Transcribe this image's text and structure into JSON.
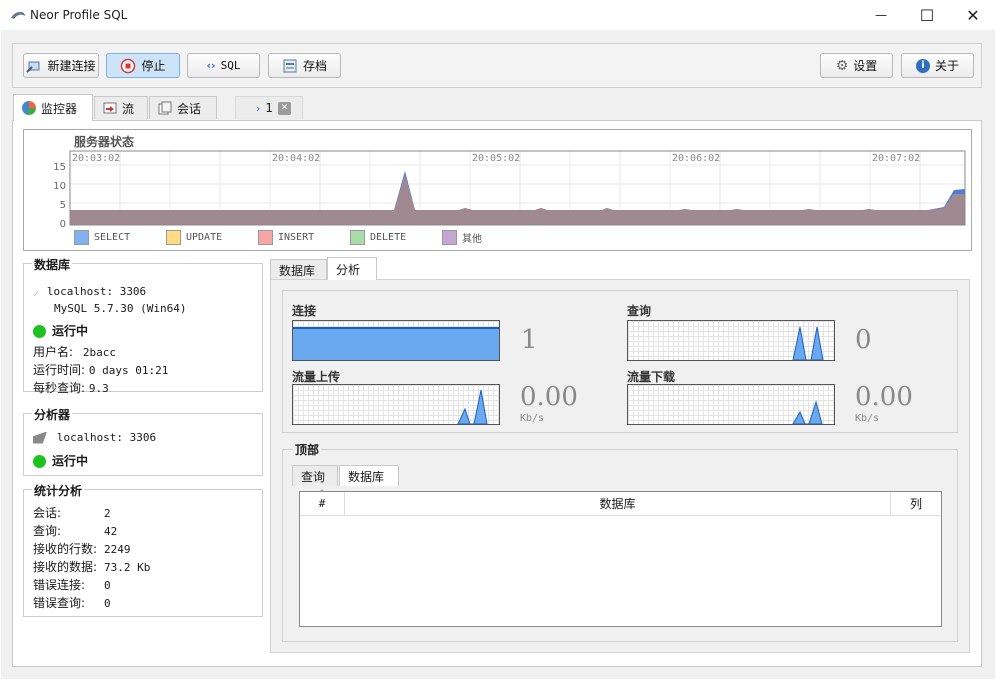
{
  "window": {
    "title": "Neor Profile SQL",
    "minimize_glyph": "—",
    "maximize_glyph": "☐",
    "close_glyph": "✕"
  },
  "toolbar": {
    "new_connection": "新建连接",
    "stop": "停止",
    "sql": "SQL",
    "save": "存档",
    "settings": "设置",
    "about": "关于"
  },
  "tabs": {
    "monitor": "监控器",
    "stream": "流",
    "session": "会话",
    "session_1": "1",
    "session_1_close": "✕"
  },
  "server_chart": {
    "title": "服务器状态",
    "times": [
      "20:03:02",
      "20:04:02",
      "20:05:02",
      "20:06:02",
      "20:07:02"
    ],
    "yticks": [
      "15",
      "10",
      "5",
      "0"
    ],
    "legend": [
      {
        "label": "SELECT",
        "color": "#7fb2ee"
      },
      {
        "label": "UPDATE",
        "color": "#ffdc82"
      },
      {
        "label": "INSERT",
        "color": "#f7a5a5"
      },
      {
        "label": "DELETE",
        "color": "#a8dca8"
      },
      {
        "label": "其他",
        "color": "#c3a6d3"
      }
    ]
  },
  "database": {
    "title": "数据库",
    "host": "localhost: 3306",
    "version": "MySQL 5.7.30 (Win64)",
    "status": "运行中",
    "user_label": "用户名:",
    "user_value": "2bacc",
    "uptime_label": "运行时间:",
    "uptime_value": "0 days 01:21",
    "qps_label": "每秒查询:",
    "qps_value": "9.3"
  },
  "analyzer": {
    "title": "分析器",
    "host": "localhost: 3306",
    "status": "运行中"
  },
  "stats": {
    "title": "统计分析",
    "rows": [
      {
        "label": "会话:",
        "value": "2"
      },
      {
        "label": "查询:",
        "value": "42"
      },
      {
        "label": "接收的行数:",
        "value": "2249"
      },
      {
        "label": "接收的数据:",
        "value": "73.2 Kb"
      },
      {
        "label": "错误连接:",
        "value": "0"
      },
      {
        "label": "错误查询:",
        "value": "0"
      }
    ]
  },
  "right_tabs": {
    "database": "数据库",
    "analysis": "分析"
  },
  "metrics": {
    "connections_label": "连接",
    "connections_value": "1",
    "queries_label": "查询",
    "queries_value": "0",
    "upload_label": "流量上传",
    "upload_value": "0.00",
    "upload_unit": "Kb/s",
    "download_label": "流量下载",
    "download_value": "0.00",
    "download_unit": "Kb/s"
  },
  "top": {
    "title": "顶部",
    "tab_query": "查询",
    "tab_database": "数据库",
    "columns": [
      "#",
      "数据库",
      "列"
    ]
  }
}
